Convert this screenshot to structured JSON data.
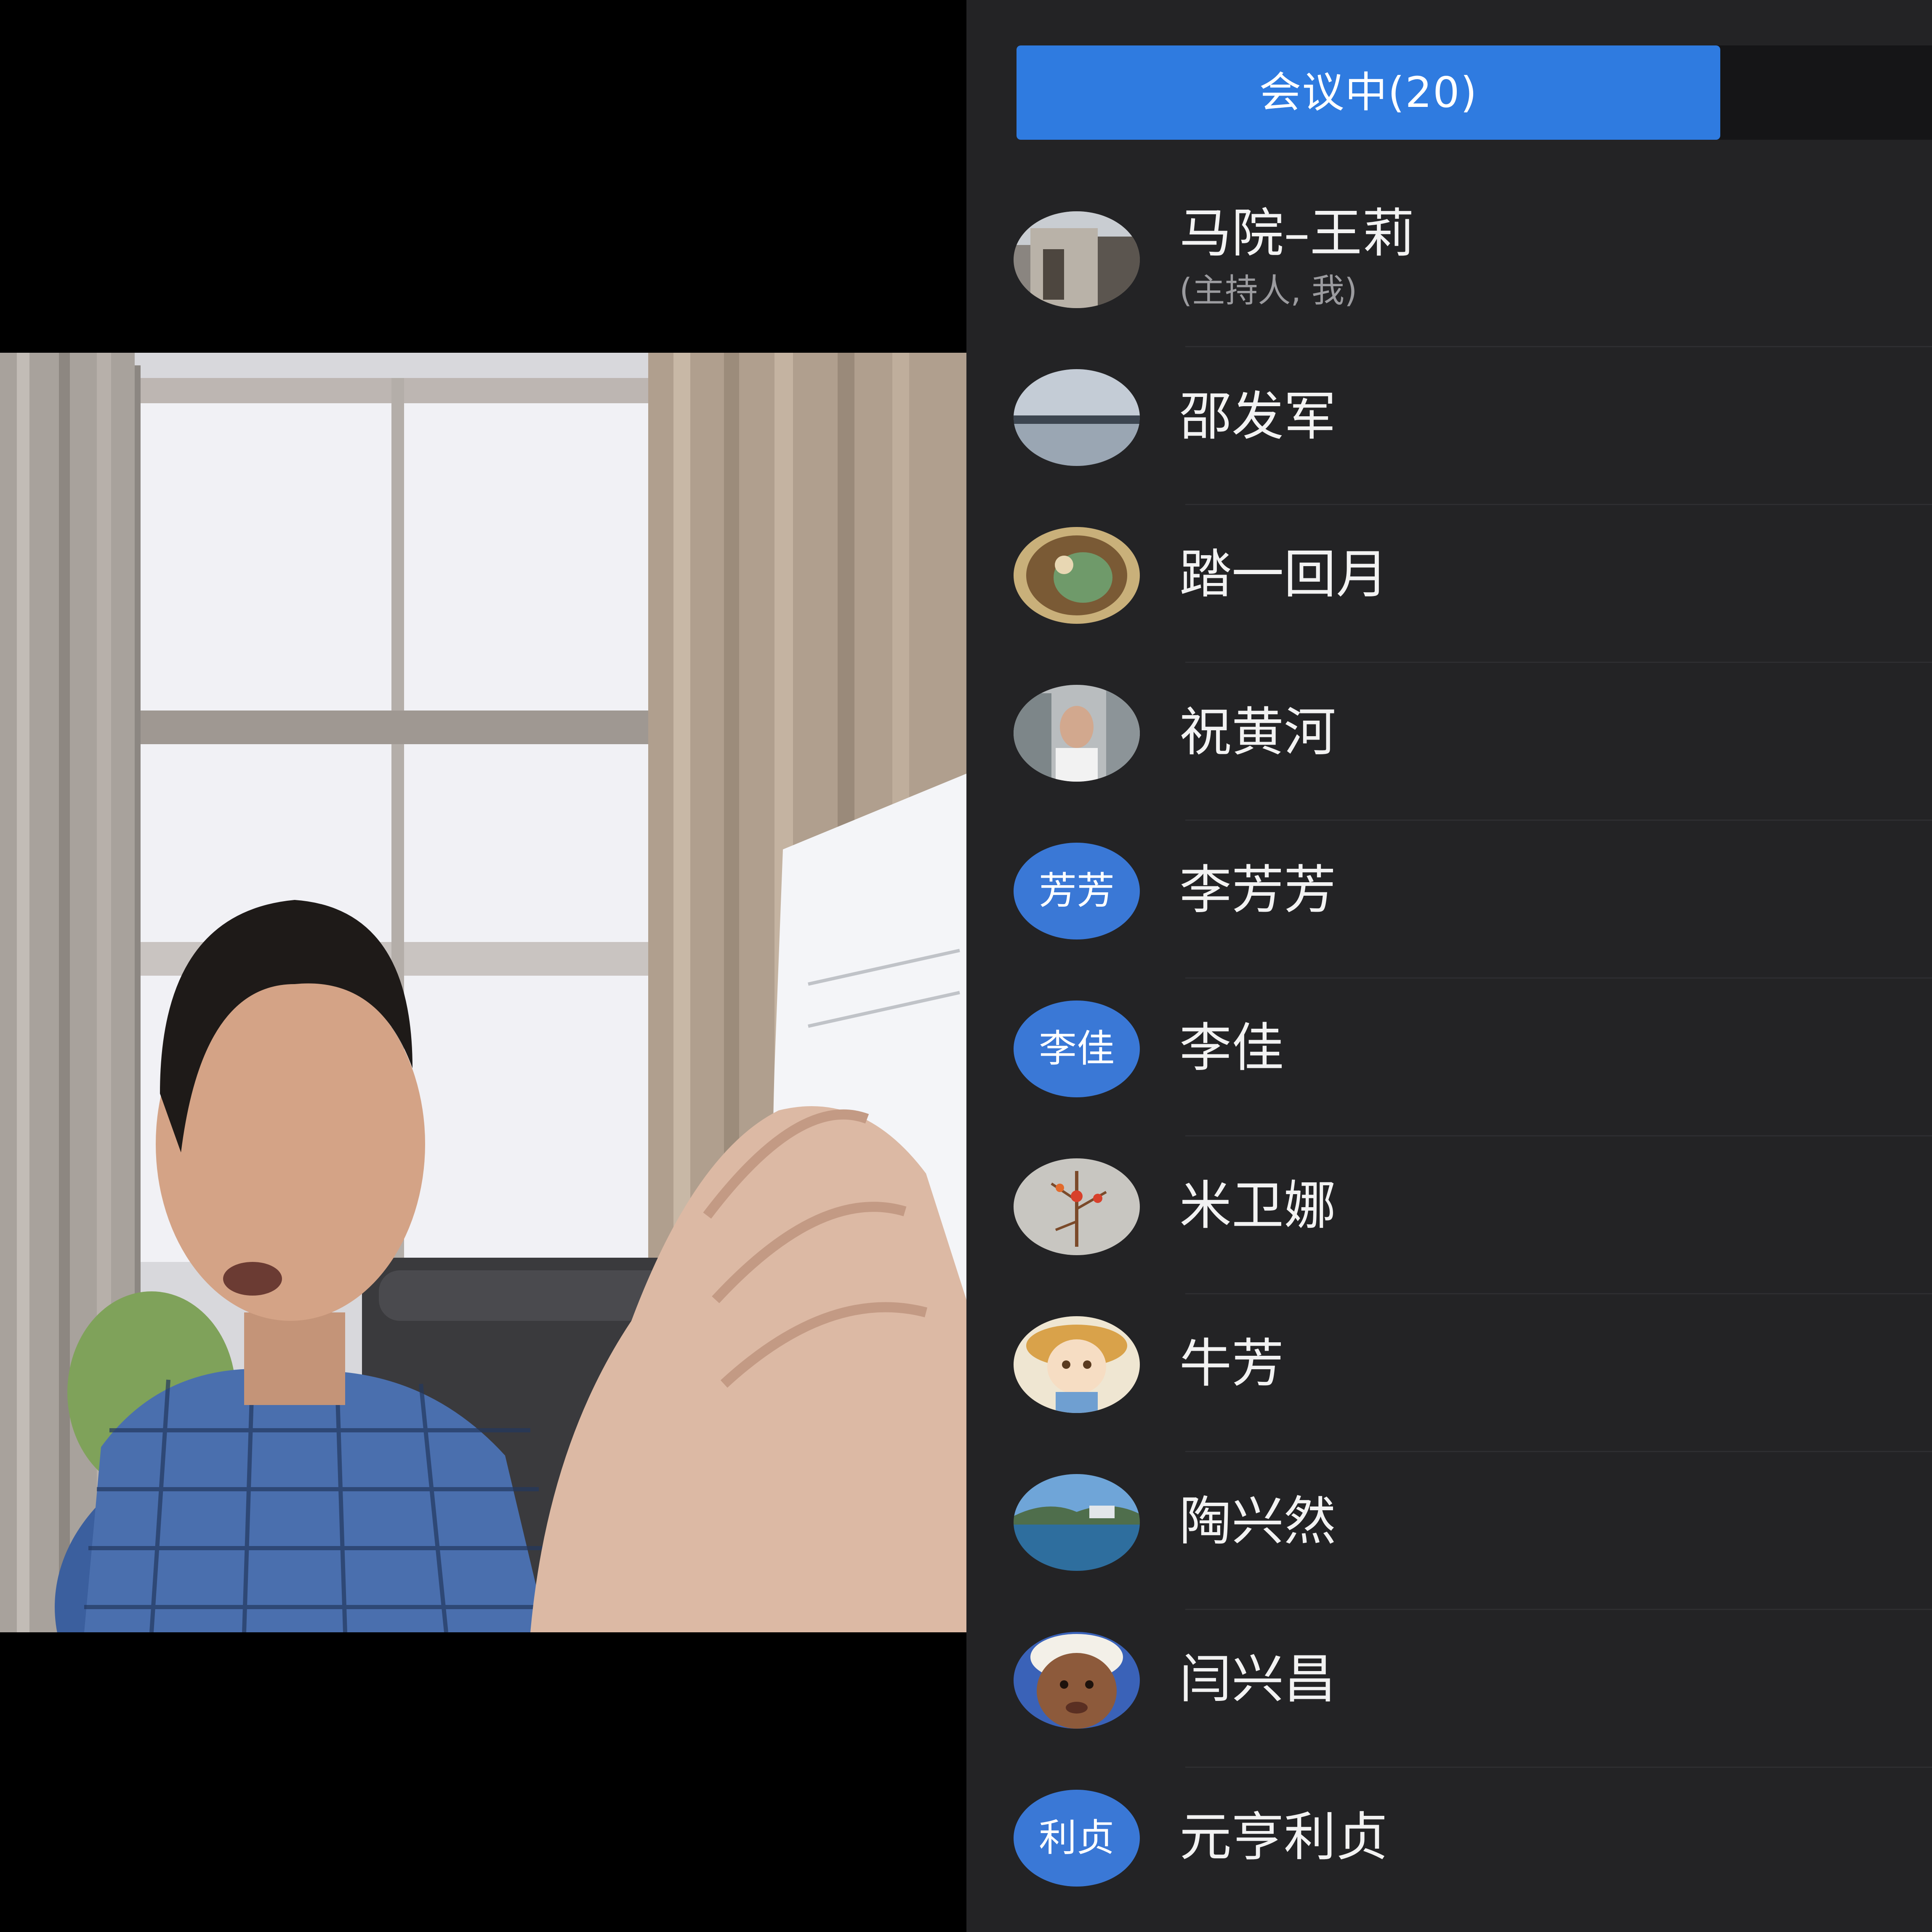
{
  "meeting": {
    "tab_label": "会议中(20)",
    "active_tab_color": "#2f7be0"
  },
  "participants": [
    {
      "name": "马院–王莉",
      "role": "(主持人, 我)",
      "avatar": "photo-building"
    },
    {
      "name": "邵发军",
      "avatar": "photo-lake"
    },
    {
      "name": "踏一回月",
      "avatar": "photo-artwork"
    },
    {
      "name": "祝黄河",
      "avatar": "photo-man"
    },
    {
      "name": "李芳芳",
      "avatar_text": "芳芳"
    },
    {
      "name": "李佳",
      "avatar_text": "李佳"
    },
    {
      "name": "米卫娜",
      "avatar": "photo-flower"
    },
    {
      "name": "牛芳",
      "avatar": "cartoon-girl"
    },
    {
      "name": "陶兴然",
      "avatar": "photo-city-water"
    },
    {
      "name": "闫兴昌",
      "avatar": "photo-face"
    },
    {
      "name": "元亨利贞",
      "avatar_text": "利贞"
    }
  ]
}
